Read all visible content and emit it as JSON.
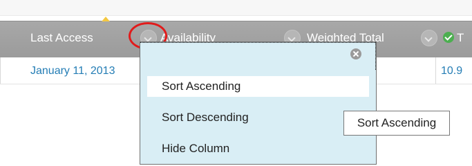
{
  "columns": {
    "last_access": "Last Access",
    "availability": "Availability",
    "weighted_total": "Weighted Total",
    "next_partial": "T"
  },
  "row": {
    "last_access_value": "January 11, 2013",
    "next_value": "10.9"
  },
  "menu": {
    "items": [
      "Sort Ascending",
      "Sort Descending",
      "Hide Column"
    ],
    "selected_index": 0
  },
  "tooltip": {
    "text": "Sort Ascending"
  },
  "colors": {
    "header_bg": "#a3a3a3",
    "link": "#247db5",
    "menu_bg": "#d9eef5",
    "highlight_circle": "#e11b1b"
  },
  "icons": [
    "chevron-down-icon",
    "close-icon",
    "check-icon",
    "sort-up-icon"
  ]
}
